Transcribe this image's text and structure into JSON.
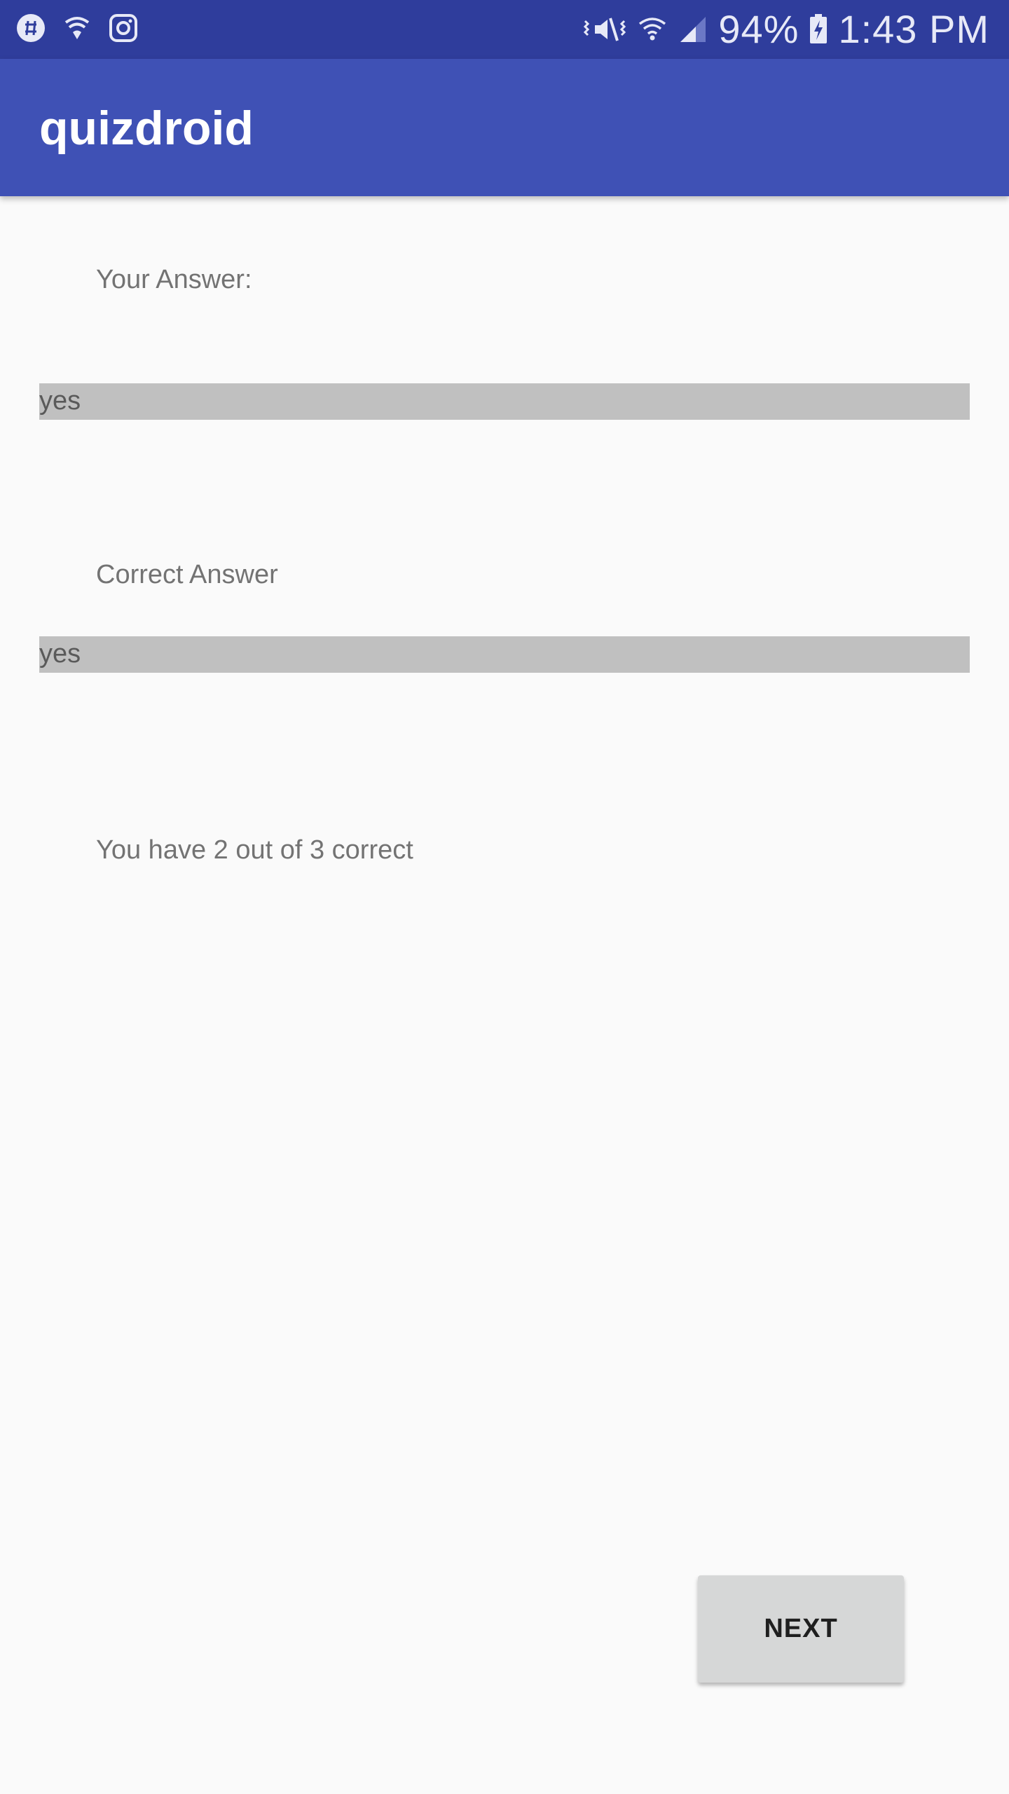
{
  "status_bar": {
    "battery_percent": "94%",
    "time": "1:43 PM",
    "left_icons": [
      "slack-icon",
      "vpn-shield-icon",
      "instagram-icon"
    ],
    "right_icons": [
      "vibrate-mute-icon",
      "wifi-icon",
      "cell-signal-icon",
      "battery-charging-icon"
    ]
  },
  "app_bar": {
    "title": "quizdroid",
    "color": "#3f51b5",
    "status_color": "#2f3d9c"
  },
  "content": {
    "your_answer_label": "Your Answer:",
    "your_answer_value": "yes",
    "correct_answer_label": "Correct Answer",
    "correct_answer_value": "yes",
    "score_text": "You have 2 out of 3 correct"
  },
  "actions": {
    "next_label": "NEXT"
  }
}
